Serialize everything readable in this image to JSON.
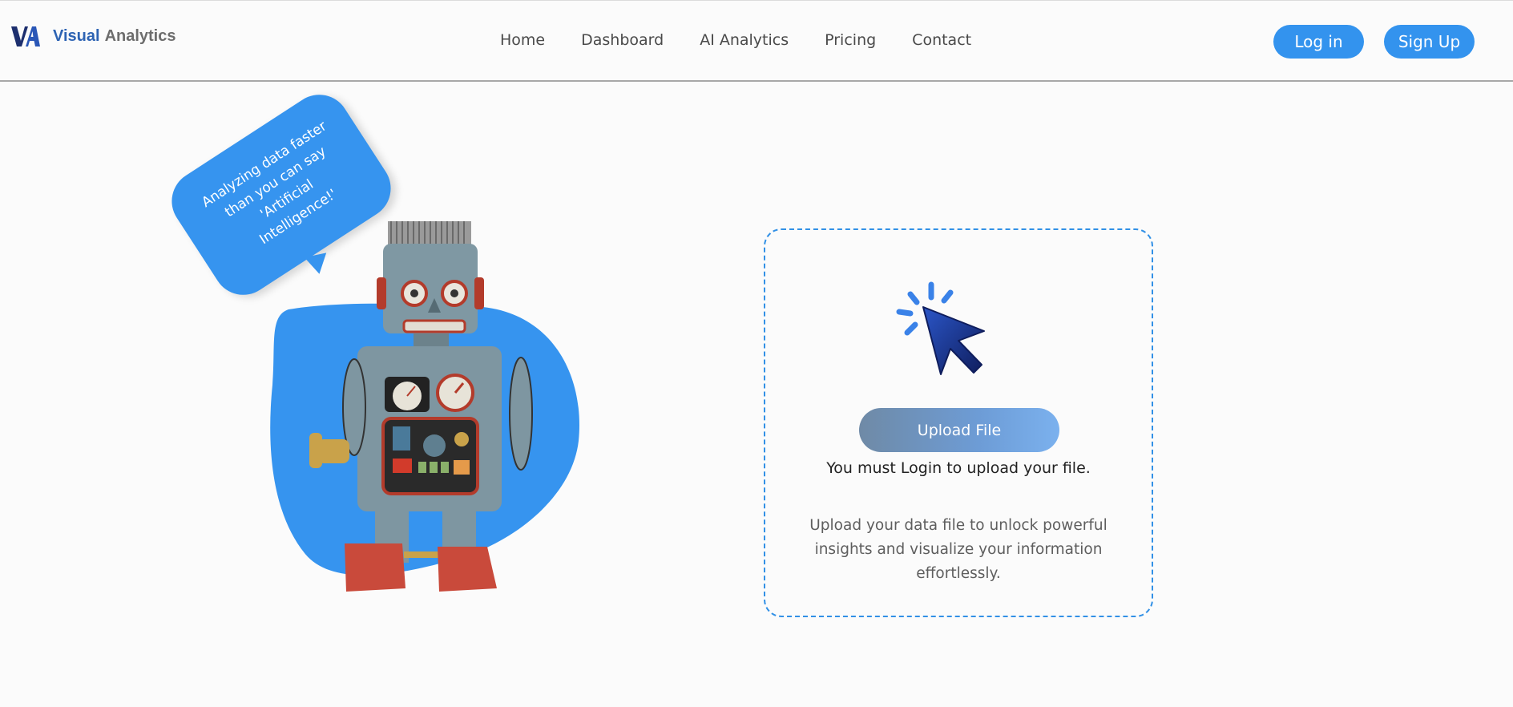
{
  "header": {
    "brand_primary": "Visual",
    "brand_secondary": "Analytics",
    "nav": [
      "Home",
      "Dashboard",
      "AI Analytics",
      "Pricing",
      "Contact"
    ],
    "login_label": "Log in",
    "signup_label": "Sign Up"
  },
  "hero": {
    "bubble_lines": [
      "Analyzing data faster",
      "than you can say",
      "'Artificial",
      "Intelligence!'"
    ]
  },
  "upload": {
    "button_label": "Upload File",
    "login_message": "You must Login to upload your file.",
    "description": "Upload your data file to unlock powerful insights and visualize your information effortlessly."
  },
  "icons": {
    "logo": "va-logo-icon",
    "cursor": "cursor-click-icon",
    "illustration": "robot-illustration"
  },
  "colors": {
    "accent": "#3393ee",
    "brand_blue": "#2d63b3",
    "card_border": "#3190e6",
    "cursor_dark": "#152a6b"
  }
}
